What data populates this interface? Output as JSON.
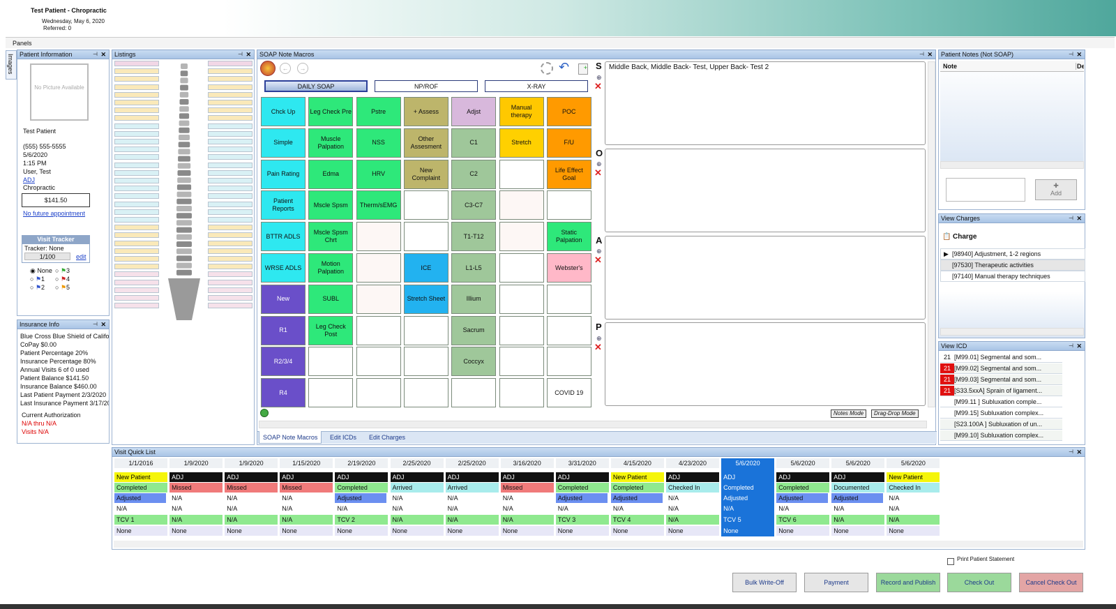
{
  "header": {
    "patient_title": "Test Patient - Chropractic",
    "date": "Wednesday, May 6, 2020",
    "referred": "Referred: 0"
  },
  "panels_label": "Panels",
  "images_tab": "Images",
  "patient_info": {
    "title": "Patient Information",
    "no_picture": "No Picture Available",
    "name": "Test Patient",
    "phone": "(555) 555-5555",
    "appt_date": "5/6/2020",
    "appt_time": "1:15 PM",
    "provider": "User, Test",
    "visit_type": "ADJ",
    "clinic": "Chropractic",
    "balance": "$141.50",
    "future_link": "No future appointment"
  },
  "visit_tracker": {
    "title": "Visit Tracker",
    "tracker": "Tracker: None",
    "count": "1/100",
    "edit": "edit",
    "options": [
      "None",
      "1",
      "2",
      "3",
      "4",
      "5"
    ]
  },
  "insurance": {
    "title": "Insurance Info",
    "carrier": "Blue Cross Blue Shield of California",
    "rows": [
      "CoPay    $0.00",
      "Patient Percentage    20%",
      "Insurance Percentage    80%",
      "Annual Visits    6 of 0 used",
      "Patient Balance    $141.50",
      "Insurance Balance    $460.00",
      "Last Patient Payment    2/3/2020",
      "Last Insurance Payment    3/17/20"
    ],
    "auth_label": "Current Authorization",
    "auth_dates": "N/A thru N/A",
    "visits": "Visits     N/A"
  },
  "listings": {
    "title": "Listings"
  },
  "soap": {
    "title": "SOAP Note Macros",
    "tabs": [
      "DAILY SOAP",
      "NP/ROF",
      "X-RAY"
    ],
    "letters": [
      "S",
      "O",
      "A",
      "P"
    ],
    "s_text": "Middle Back, Middle Back- Test, Upper Back- Test 2",
    "notes_mode": "Notes Mode",
    "dragdrop_mode": "Drag-Drop Mode",
    "bottom_tabs": [
      "SOAP Note Macros",
      "Edit ICDs",
      "Edit Charges"
    ],
    "columns": [
      [
        "Chck Up",
        "Simple",
        "Pain Rating",
        "Patient Reports",
        "BTTR ADLS",
        "WRSE ADLS",
        "New",
        "R1",
        "R2/3/4",
        "R4"
      ],
      [
        "Leg Check Pre",
        "Muscle Palpation",
        "Edma",
        "Mscle Spsm",
        "Mscle Spsm Chrt",
        "Motion Palpation",
        "SUBL",
        "Leg Check Post",
        "",
        ""
      ],
      [
        "Pstre",
        "NSS",
        "HRV",
        "Therm/sEMG",
        "",
        "",
        "",
        "",
        "",
        ""
      ],
      [
        "+ Assess",
        "Other Assesment",
        "New Complaint",
        "",
        "",
        "ICE",
        "Stretch Sheet",
        "",
        "",
        ""
      ],
      [
        "Adjst",
        "C1",
        "C2",
        "C3-C7",
        "T1-T12",
        "L1-L5",
        "Illium",
        "Sacrum",
        "Coccyx",
        ""
      ],
      [
        "Manual therapy",
        "Stretch",
        "",
        "",
        "",
        "",
        "",
        "",
        "",
        ""
      ],
      [
        "POC",
        "F/U",
        "Life Effect Goal",
        "",
        "Static Palpation",
        "Webster's",
        "",
        "",
        "",
        "COVID 19"
      ]
    ]
  },
  "patient_notes": {
    "title": "Patient Notes (Not SOAP)",
    "col_note": "Note",
    "col_del": "Del",
    "add": "Add"
  },
  "view_charges": {
    "title": "View Charges",
    "header": "Charge",
    "items": [
      "[98940] Adjustment, 1-2 regions",
      "[97530] Therapeutic activities",
      "[97140] Manual therapy techniques"
    ]
  },
  "view_icd": {
    "title": "View ICD",
    "items": [
      {
        "n": "21",
        "t": "[M99.01]  Segmental and som...",
        "red": false
      },
      {
        "n": "21",
        "t": "[M99.02]  Segmental and som...",
        "red": true
      },
      {
        "n": "21",
        "t": "[M99.03]  Segmental and som...",
        "red": true
      },
      {
        "n": "21",
        "t": "[S33.5xxA]  Sprain of ligament...",
        "red": true
      },
      {
        "n": "",
        "t": "[M99.11  ]  Subluxation comple...",
        "red": false
      },
      {
        "n": "",
        "t": "[M99.15]  Subluxation complex...",
        "red": false
      },
      {
        "n": "",
        "t": "[S23.100A  ]  Subluxation of un...",
        "red": false
      },
      {
        "n": "",
        "t": "[M99.10]  Subluxation complex...",
        "red": false
      }
    ]
  },
  "visit_quick_list": {
    "title": "Visit Quick List",
    "visits": [
      {
        "date": "1/1/2016",
        "type": "New Patient",
        "status": "Completed",
        "adj": "Adjusted",
        "r4": "N/A",
        "tcv": "TCV 1",
        "last": "None"
      },
      {
        "date": "1/9/2020",
        "type": "ADJ",
        "status": "Missed",
        "adj": "N/A",
        "r4": "N/A",
        "tcv": "N/A",
        "last": "None"
      },
      {
        "date": "1/9/2020",
        "type": "ADJ",
        "status": "Missed",
        "adj": "N/A",
        "r4": "N/A",
        "tcv": "N/A",
        "last": "None"
      },
      {
        "date": "1/15/2020",
        "type": "ADJ",
        "status": "Missed",
        "adj": "N/A",
        "r4": "N/A",
        "tcv": "N/A",
        "last": "None"
      },
      {
        "date": "2/19/2020",
        "type": "ADJ",
        "status": "Completed",
        "adj": "Adjusted",
        "r4": "N/A",
        "tcv": "TCV 2",
        "last": "None"
      },
      {
        "date": "2/25/2020",
        "type": "ADJ",
        "status": "Arrived",
        "adj": "N/A",
        "r4": "N/A",
        "tcv": "N/A",
        "last": "None"
      },
      {
        "date": "2/25/2020",
        "type": "ADJ",
        "status": "Arrived",
        "adj": "N/A",
        "r4": "N/A",
        "tcv": "N/A",
        "last": "None"
      },
      {
        "date": "3/16/2020",
        "type": "ADJ",
        "status": "Missed",
        "adj": "N/A",
        "r4": "N/A",
        "tcv": "N/A",
        "last": "None"
      },
      {
        "date": "3/31/2020",
        "type": "ADJ",
        "status": "Completed",
        "adj": "Adjusted",
        "r4": "N/A",
        "tcv": "TCV 3",
        "last": "None"
      },
      {
        "date": "4/15/2020",
        "type": "New Patient",
        "status": "Completed",
        "adj": "Adjusted",
        "r4": "N/A",
        "tcv": "TCV 4",
        "last": "None"
      },
      {
        "date": "4/23/2020",
        "type": "ADJ",
        "status": "Checked In",
        "adj": "N/A",
        "r4": "N/A",
        "tcv": "N/A",
        "last": "None"
      },
      {
        "date": "5/6/2020",
        "type": "ADJ",
        "status": "Completed",
        "adj": "Adjusted",
        "r4": "N/A",
        "tcv": "TCV 5",
        "last": "None"
      },
      {
        "date": "5/6/2020",
        "type": "ADJ",
        "status": "Completed",
        "adj": "Adjusted",
        "r4": "N/A",
        "tcv": "TCV 6",
        "last": "None"
      },
      {
        "date": "5/6/2020",
        "type": "ADJ",
        "status": "Documented",
        "adj": "Adjusted",
        "r4": "N/A",
        "tcv": "N/A",
        "last": "None"
      },
      {
        "date": "5/6/2020",
        "type": "New Patient",
        "status": "Checked In",
        "adj": "N/A",
        "r4": "N/A",
        "tcv": "N/A",
        "last": "None"
      }
    ],
    "selected_index": 11
  },
  "footer": {
    "print_statement": "Print Patient Statement",
    "bulk": "Bulk Write-Off",
    "payment": "Payment",
    "record": "Record and Publish",
    "checkout": "Check Out",
    "cancel_checkout": "Cancel Check Out"
  }
}
